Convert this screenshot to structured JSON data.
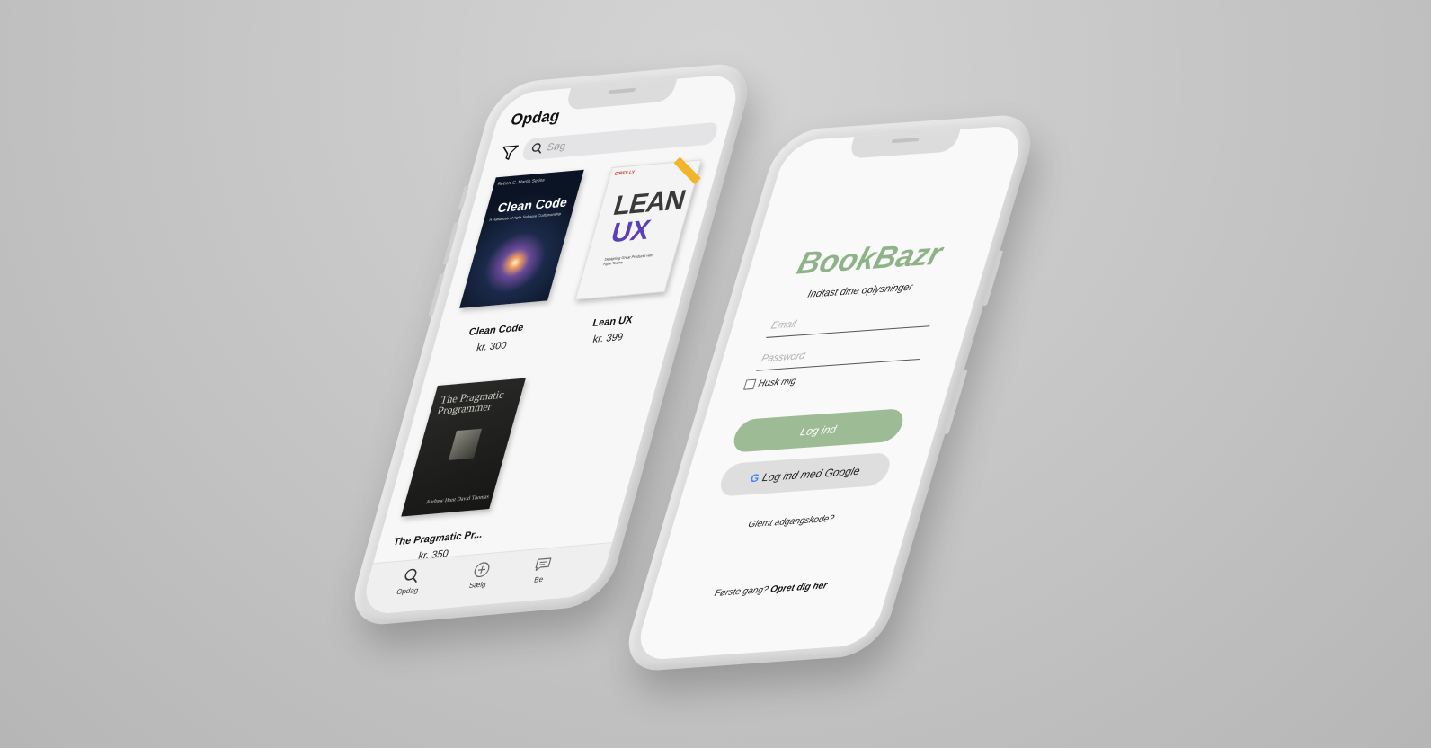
{
  "left_phone": {
    "header": {
      "title": "Opdag"
    },
    "search": {
      "placeholder": "Søg",
      "filter_icon": "filter-icon",
      "search_icon": "search-icon"
    },
    "books": [
      {
        "title": "Clean Code",
        "price": "kr. 300",
        "cover": {
          "top": "Robert C. Martin Series",
          "title": "Clean Code",
          "subtitle": "A Handbook of Agile Software Craftsmanship"
        }
      },
      {
        "title": "Lean UX",
        "price": "kr. 399",
        "cover": {
          "publisher": "O'REILLY",
          "line1": "LEAN",
          "line2": "UX",
          "subtitle": "Designing Great Products with Agile Teams"
        }
      },
      {
        "title": "The Pragmatic Pr...",
        "price": "kr. 350",
        "cover": {
          "title": "The Pragmatic Programmer",
          "authors": "Andrew Hunt David Thomas"
        }
      }
    ],
    "tabbar": [
      {
        "label": "Opdag",
        "icon": "search-icon"
      },
      {
        "label": "Sælg",
        "icon": "plus-circle-icon"
      },
      {
        "label": "Be",
        "icon": "chat-icon"
      }
    ]
  },
  "right_phone": {
    "brand": "BookBazr",
    "subtitle": "Indtast dine oplysninger",
    "email_placeholder": "Email",
    "password_placeholder": "Password",
    "remember_label": "Husk mig",
    "login_button": "Log ind",
    "google_button": "Log ind med Google",
    "google_logo": "G",
    "forgot_link": "Glemt adgangskode?",
    "signup_prompt": "Første gang?",
    "signup_link": "Opret dig her"
  }
}
